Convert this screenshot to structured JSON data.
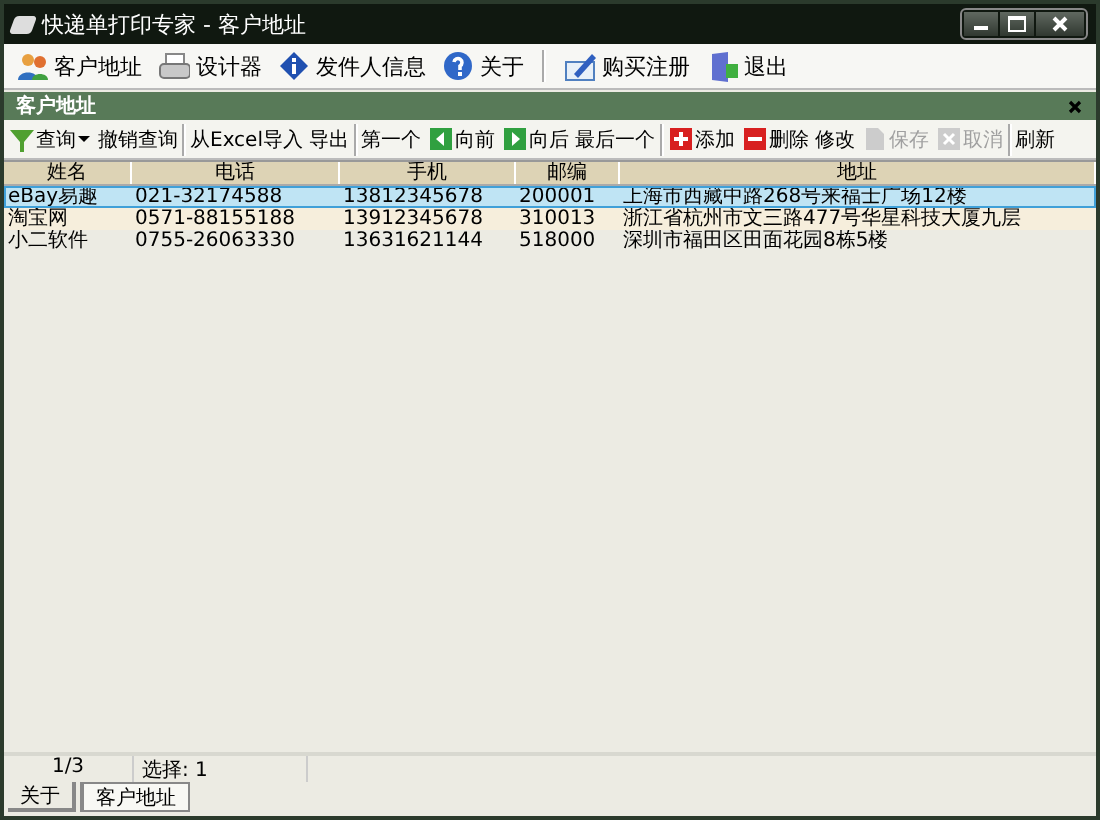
{
  "window": {
    "title": "快递单打印专家 - 客户地址"
  },
  "main_toolbar": {
    "groups": [
      [
        {
          "label": "客户地址",
          "kind": "people"
        },
        {
          "label": "设计器",
          "kind": "printer"
        },
        {
          "label": "发件人信息",
          "kind": "info"
        },
        {
          "label": "关于",
          "kind": "help"
        }
      ],
      [
        {
          "label": "购买注册",
          "kind": "register"
        },
        {
          "label": "退出",
          "kind": "exit"
        }
      ]
    ]
  },
  "panel": {
    "title": "客户地址"
  },
  "data_toolbar": {
    "groups": [
      [
        {
          "label": "查询",
          "kind": "filter",
          "disabled": false
        },
        {
          "label": "撤销查询",
          "kind": "plain",
          "disabled": false
        }
      ],
      [
        {
          "label": "从Excel导入",
          "kind": "plain",
          "disabled": false
        },
        {
          "label": "导出",
          "kind": "plain",
          "disabled": false
        }
      ],
      [
        {
          "label": "第一个",
          "kind": "plain",
          "disabled": false
        },
        {
          "label": "向前",
          "kind": "prev",
          "disabled": false
        },
        {
          "label": "向后",
          "kind": "next",
          "disabled": false
        },
        {
          "label": "最后一个",
          "kind": "plain",
          "disabled": false
        }
      ],
      [
        {
          "label": "添加",
          "kind": "add",
          "disabled": false
        },
        {
          "label": "删除",
          "kind": "remove",
          "disabled": false
        },
        {
          "label": "修改",
          "kind": "plain",
          "disabled": false
        },
        {
          "label": "保存",
          "kind": "save",
          "disabled": true
        },
        {
          "label": "取消",
          "kind": "cancel",
          "disabled": true
        }
      ],
      [
        {
          "label": "刷新",
          "kind": "plain",
          "disabled": false
        }
      ]
    ]
  },
  "table": {
    "columns": [
      "姓名",
      "电话",
      "手机",
      "邮编",
      "地址"
    ],
    "rows": [
      {
        "cells": [
          "eBay易趣",
          "021-32174588",
          "13812345678",
          "200001",
          "上海市西藏中路268号来福士广场12楼"
        ],
        "selected": true
      },
      {
        "cells": [
          "淘宝网",
          "0571-88155188",
          "13912345678",
          "310013",
          "浙江省杭州市文三路477号华星科技大厦九层"
        ],
        "selected": false
      },
      {
        "cells": [
          "小二软件",
          "0755-26063330",
          "13631621144",
          "518000",
          "深圳市福田区田面花园8栋5楼"
        ],
        "selected": false
      }
    ]
  },
  "status_bar": {
    "record": "1/3",
    "selection": "选择: 1"
  },
  "bottom_tabs": [
    {
      "label": "关于",
      "selected": false
    },
    {
      "label": "客户地址",
      "selected": true
    }
  ]
}
